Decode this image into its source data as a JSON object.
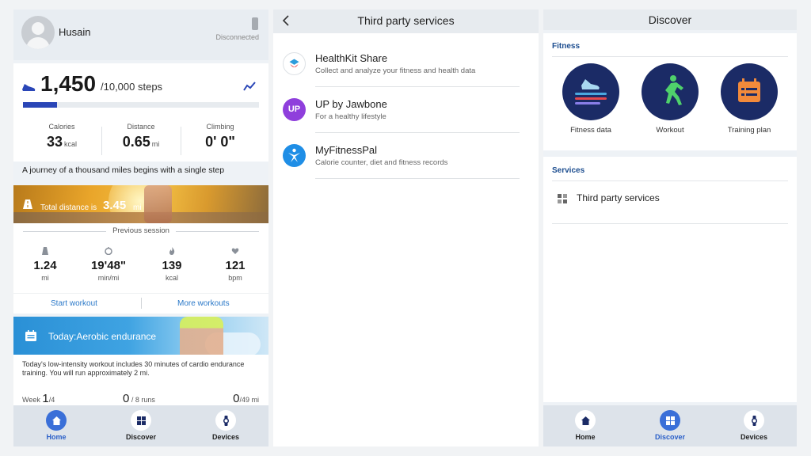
{
  "home": {
    "user_name": "Husain",
    "connection_status": "Disconnected",
    "steps": {
      "count": "1,450",
      "goal": "/10,000 steps",
      "progress_fraction": 0.145
    },
    "stats": [
      {
        "label": "Calories",
        "value": "33",
        "unit": "kcal"
      },
      {
        "label": "Distance",
        "value": "0.65",
        "unit": "mi"
      },
      {
        "label": "Climbing",
        "value": "0' 0\"",
        "unit": ""
      }
    ],
    "quote": "A journey of a thousand miles begins with a single step",
    "total_distance": {
      "label": "Total distance is",
      "value": "3.45",
      "unit": "mi"
    },
    "previous_session": {
      "title": "Previous session",
      "stats": [
        {
          "icon": "road-icon",
          "value": "1.24",
          "unit": "mi"
        },
        {
          "icon": "timer-icon",
          "value": "19'48\"",
          "unit": "min/mi"
        },
        {
          "icon": "flame-icon",
          "value": "139",
          "unit": "kcal"
        },
        {
          "icon": "heart-icon",
          "value": "121",
          "unit": "bpm"
        }
      ]
    },
    "actions": {
      "start": "Start workout",
      "more": "More workouts"
    },
    "workout": {
      "title": "Today:Aerobic endurance",
      "description": "Today's low-intensity workout includes 30 minutes of cardio endurance training. You will run approximately 2 mi.",
      "week_label": "Week",
      "week_value": "1",
      "week_total": "/4",
      "runs_value": "0",
      "runs_total": "/ 8 runs",
      "miles_value": "0",
      "miles_total": "/49 mi"
    },
    "tabs": [
      "Home",
      "Discover",
      "Devices"
    ]
  },
  "third_party": {
    "title": "Third party services",
    "services": [
      {
        "name": "HealthKit Share",
        "description": "Collect and analyze your fitness and health data",
        "icon": "healthkit-icon"
      },
      {
        "name": "UP by Jawbone",
        "description": "For a healthy lifestyle",
        "icon": "up-jawbone-icon",
        "badge": "UP"
      },
      {
        "name": "MyFitnessPal",
        "description": "Calorie counter, diet and fitness records",
        "icon": "myfitnesspal-icon"
      }
    ]
  },
  "discover": {
    "title": "Discover",
    "fitness_label": "Fitness",
    "tiles": [
      {
        "label": "Fitness data",
        "icon": "fitness-data-icon"
      },
      {
        "label": "Workout",
        "icon": "runner-icon"
      },
      {
        "label": "Training plan",
        "icon": "calendar-icon"
      }
    ],
    "services_label": "Services",
    "services_item": "Third party services",
    "tabs": [
      "Home",
      "Discover",
      "Devices"
    ]
  },
  "colors": {
    "accent": "#3a6fd8",
    "progress": "#2a46b7",
    "link": "#2a78c8",
    "tile_disc": "#1b2b66"
  }
}
